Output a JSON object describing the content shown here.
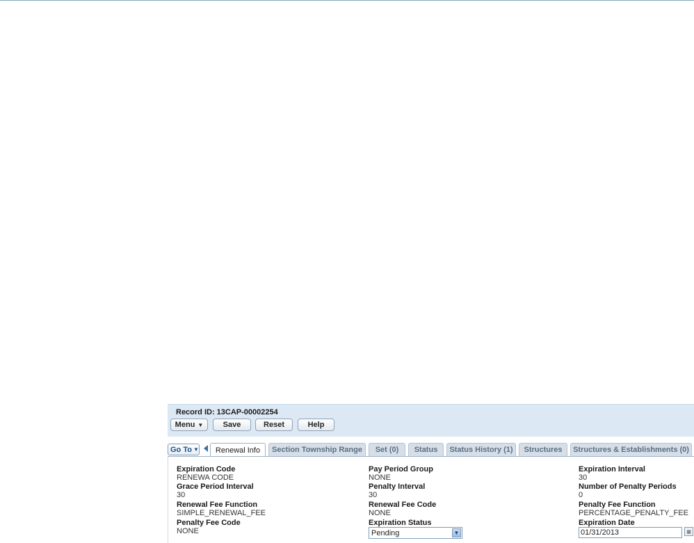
{
  "record": {
    "title": "Record ID: 13CAP-00002254",
    "buttons": {
      "menu": "Menu",
      "save": "Save",
      "reset": "Reset",
      "help": "Help"
    }
  },
  "tabs": {
    "goto": "Go To",
    "items": [
      {
        "label": "Renewal Info",
        "active": true
      },
      {
        "label": "Section Township Range"
      },
      {
        "label": "Set (0)"
      },
      {
        "label": "Status"
      },
      {
        "label": "Status History (1)"
      },
      {
        "label": "Structures"
      },
      {
        "label": "Structures & Establishments (0)"
      }
    ]
  },
  "fields": {
    "col1": [
      {
        "label": "Expiration Code",
        "value": "RENEWA CODE"
      },
      {
        "label": "Grace Period Interval",
        "value": "30"
      },
      {
        "label": "Renewal Fee Function",
        "value": "SIMPLE_RENEWAL_FEE"
      },
      {
        "label": "Penalty Fee Code",
        "value": "NONE"
      }
    ],
    "col2": [
      {
        "label": "Pay Period Group",
        "value": "NONE"
      },
      {
        "label": "Penalty Interval",
        "value": "30"
      },
      {
        "label": "Renewal Fee Code",
        "value": "NONE"
      },
      {
        "label": "Expiration Status",
        "value": "Pending"
      }
    ],
    "col3": [
      {
        "label": "Expiration Interval",
        "value": "30"
      },
      {
        "label": "Number of Penalty Periods",
        "value": "0"
      },
      {
        "label": "Penalty Fee Function",
        "value": "PERCENTAGE_PENALTY_FEE"
      },
      {
        "label": "Expiration Date",
        "value": "01/31/2013"
      }
    ]
  },
  "icons": {
    "menu_caret": "chevron-down-icon",
    "goto_caret": "chevron-down-icon",
    "tab_scroll_left": "triangle-left-icon",
    "select_arrow": "chevron-down-icon",
    "calendar": "calendar-icon"
  }
}
